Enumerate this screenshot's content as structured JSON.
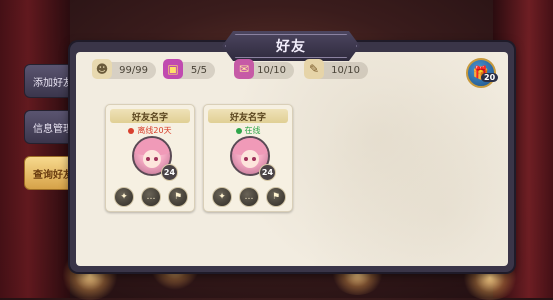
{
  "window": {
    "title": "好友"
  },
  "resources": [
    {
      "icon": "friends-count-icon",
      "value": "99/99"
    },
    {
      "icon": "gift-box-icon",
      "value": "5/5"
    },
    {
      "icon": "mail-icon",
      "value": "10/10"
    },
    {
      "icon": "stamina-icon",
      "value": "10/10"
    }
  ],
  "gift_button": {
    "icon": "gift-icon",
    "count": "20"
  },
  "tabs": [
    {
      "label": "添加好友",
      "active": false
    },
    {
      "label": "信息管理",
      "active": false
    },
    {
      "label": "查询好友",
      "active": true
    }
  ],
  "friends": [
    {
      "name": "好友名字",
      "status": "离线20天",
      "status_color": "#d8402e",
      "level": "24"
    },
    {
      "name": "好友名字",
      "status": "在线",
      "status_color": "#2fa64a",
      "level": "24"
    }
  ],
  "colors": {
    "accent": "#d6a248",
    "panel": "#f2ece0",
    "frame": "#3a3548"
  }
}
